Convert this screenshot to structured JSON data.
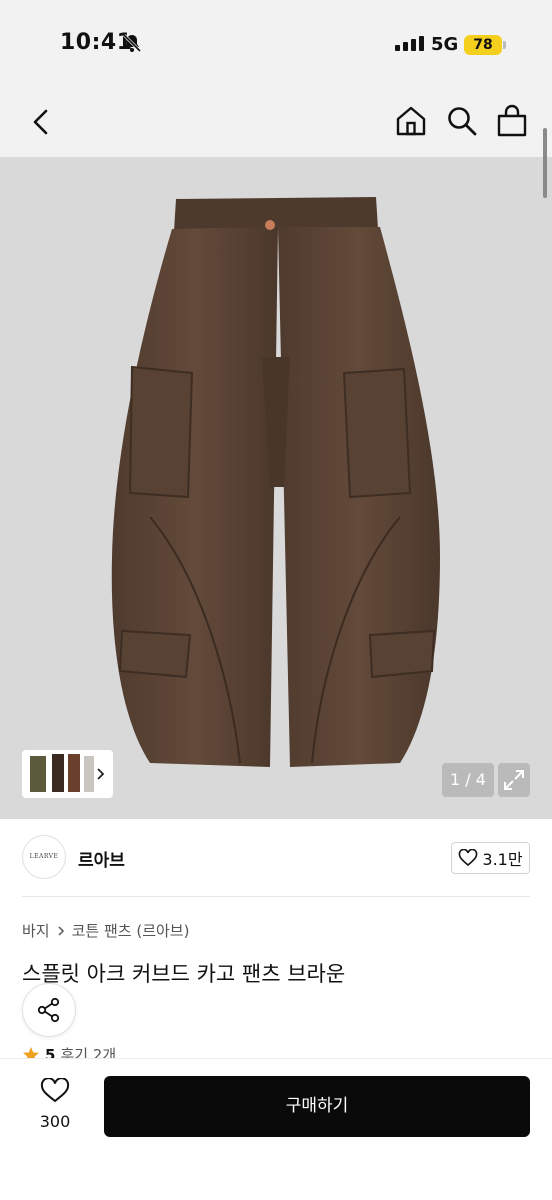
{
  "status_bar": {
    "time": "10:41",
    "network": "5G",
    "battery": "78"
  },
  "gallery": {
    "counter": "1 / 4"
  },
  "shop": {
    "logo_text": "LEARVE",
    "name": "르아브",
    "likes": "3.1만"
  },
  "product": {
    "breadcrumb": [
      "바지",
      "코튼 팬츠 (르아브)"
    ],
    "title": "스플릿 아크 커브드 카고 팬츠 브라운",
    "rating": "5",
    "reviews": "후기 2개"
  },
  "bottom_bar": {
    "wish_count": "300",
    "buy_label": "구매하기"
  },
  "colors": {
    "accent": "#0a0a0a",
    "battery": "#f5cf1d",
    "star": "#f0a020"
  }
}
